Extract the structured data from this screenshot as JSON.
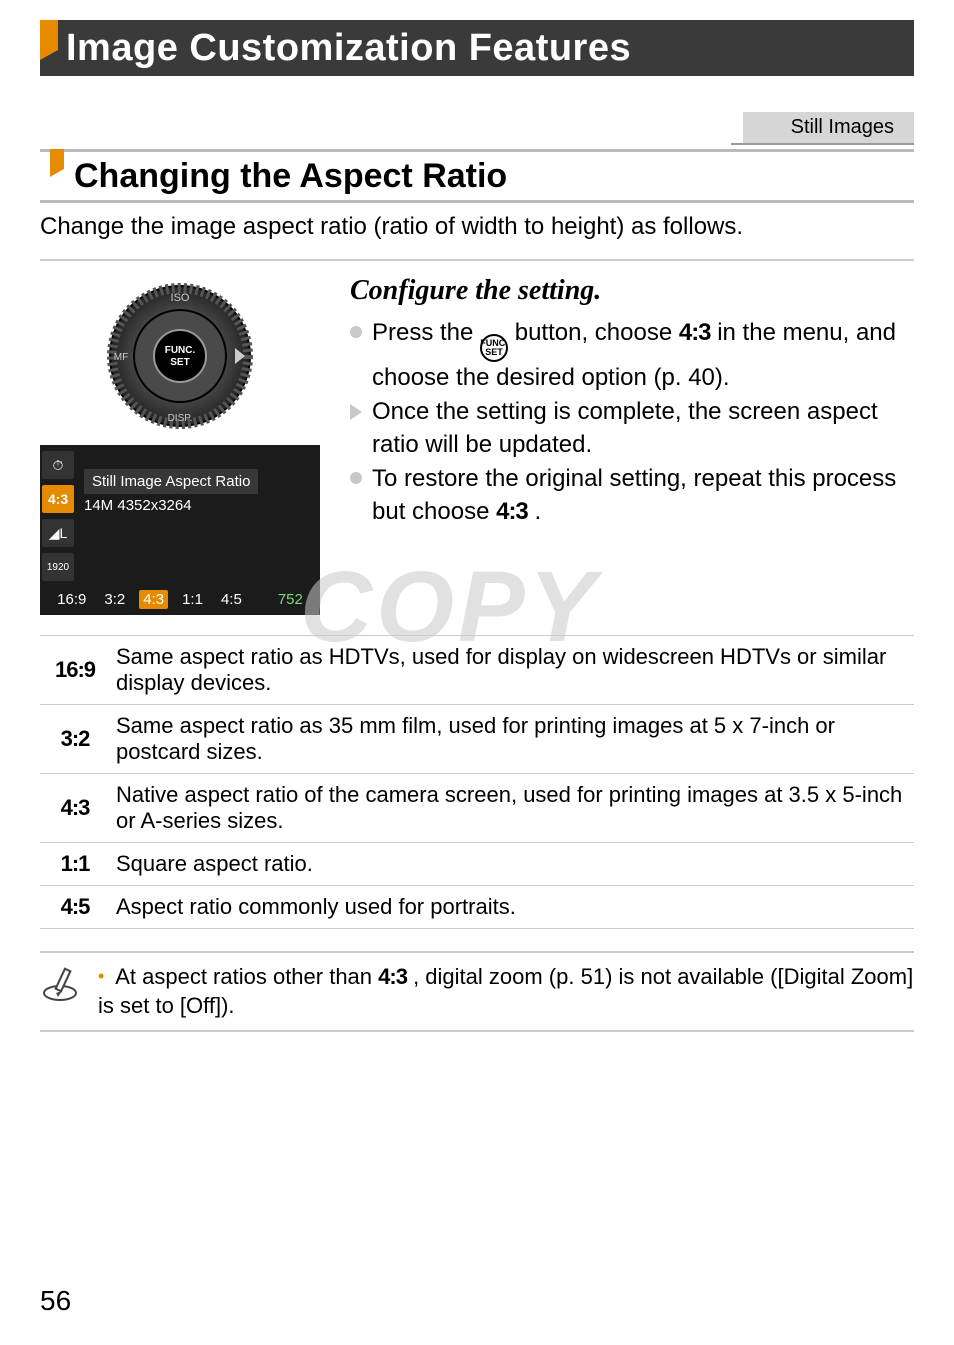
{
  "chapter_title": "Image Customization Features",
  "tag": "Still Images",
  "section_title": "Changing the Aspect Ratio",
  "intro": "Change the image aspect ratio (ratio of width to height) as follows.",
  "disc": {
    "top": "ISO",
    "right": "",
    "bottom": "DISP.",
    "left": "MF",
    "center_top": "FUNC.",
    "center_bottom": "SET"
  },
  "screen": {
    "left_icons": [
      "⚙",
      "4:3",
      "◢L",
      "1920"
    ],
    "label": "Still Image Aspect Ratio",
    "sub": "14M 4352x3264",
    "options": [
      "16:9",
      "3:2",
      "4:3",
      "1:1",
      "4:5"
    ],
    "selected": "4:3",
    "count": "752"
  },
  "step": {
    "heading": "Configure the setting.",
    "b1a": "Press the ",
    "b1b": " button, choose ",
    "b1_ratio": "4:3",
    "b1c": " in the menu, and choose the desired option (p. 40).",
    "b2": "Once the setting is complete, the screen aspect ratio will be updated.",
    "b3a": "To restore the original setting, repeat this process but choose ",
    "b3_ratio": "4:3",
    "b3b": "."
  },
  "func_label_top": "FUNC.",
  "func_label_bot": "SET",
  "table": {
    "r1": {
      "label": "16:9",
      "desc": "Same aspect ratio as HDTVs, used for display on widescreen HDTVs or similar display devices."
    },
    "r2": {
      "label": "3:2",
      "desc": "Same aspect ratio as 35 mm film, used for printing images at 5 x 7-inch or postcard sizes."
    },
    "r3": {
      "label": "4:3",
      "desc": "Native aspect ratio of the camera screen, used for printing images at 3.5 x 5-inch or A-series sizes."
    },
    "r4": {
      "label": "1:1",
      "desc": "Square aspect ratio."
    },
    "r5": {
      "label": "4:5",
      "desc": "Aspect ratio commonly used for portraits."
    }
  },
  "note": {
    "a": "At aspect ratios other than ",
    "ratio": "4:3",
    "b": ", digital zoom (p. 51) is not available ([Digital Zoom] is set to [Off])."
  },
  "watermark": "COPY",
  "page_number": "56"
}
